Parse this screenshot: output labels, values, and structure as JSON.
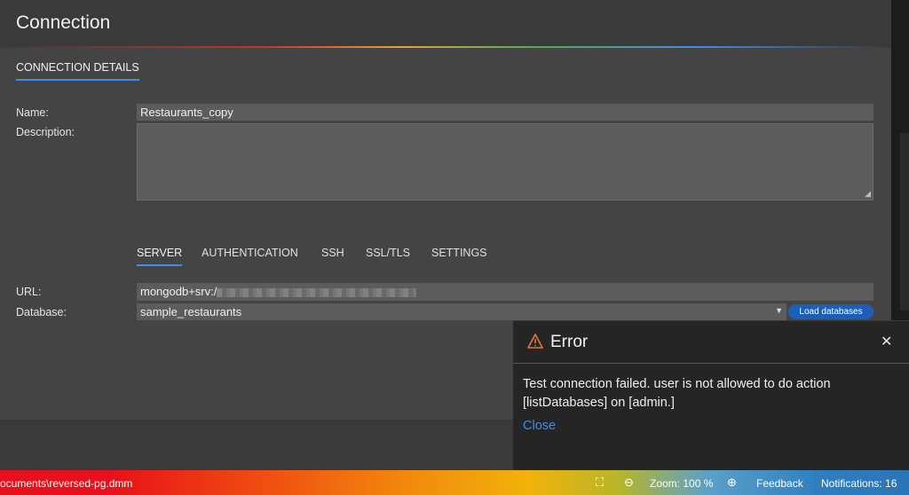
{
  "dialog": {
    "title": "Connection",
    "details_tab": "CONNECTION DETAILS",
    "name_label": "Name:",
    "name_value": "Restaurants_copy",
    "description_label": "Description:",
    "description_value": "",
    "tabs": [
      "SERVER",
      "AUTHENTICATION",
      "SSH",
      "SSL/TLS",
      "SETTINGS"
    ],
    "active_tab": "SERVER",
    "url_label": "URL:",
    "url_value": "mongodb+srv:/",
    "database_label": "Database:",
    "database_value": "sample_restaurants",
    "load_databases": "Load databases"
  },
  "error": {
    "title": "Error",
    "message": "Test connection failed. user is not allowed to do action [listDatabases] on [admin.]",
    "close": "Close"
  },
  "status_bar": {
    "file_path": "ocuments\\reversed-pg.dmm",
    "zoom": "Zoom: 100 %",
    "feedback": "Feedback",
    "notifications": "Notifications: 16"
  },
  "colors": {
    "accent": "#3f8ee8",
    "warning": "#e8763a",
    "button": "#1c5fb8"
  },
  "icons": {
    "warning": "warning-icon",
    "close": "close-icon",
    "fullscreen": "fullscreen-icon",
    "zoom_out": "zoom-out-icon",
    "zoom_in": "zoom-in-icon",
    "select_arrow": "chevron-down-icon"
  }
}
